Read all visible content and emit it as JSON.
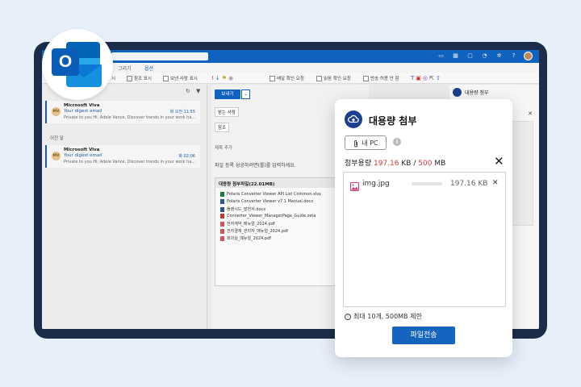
{
  "tabs": [
    "그리기",
    "옵션"
  ],
  "ribbon": {
    "items": [
      "참조 표시",
      "보낸 사람 표시",
      "배달 확인 요청",
      "읽음 확인 요청",
      "반송 허용 안 함"
    ],
    "left_text": "시"
  },
  "messages": [
    {
      "avatar": "MV",
      "from": "Microsoft Viva",
      "subject": "Your digest email",
      "time": "화 오전 11:55",
      "preview": "Private to you Hi, Adele Vance, Discover trends in your work ha..."
    },
    {
      "avatar": "MV",
      "from": "Microsoft Viva",
      "subject": "Your digest email",
      "time": "화 02:06",
      "preview": "Private to you Hi, Adele Vance, Discover trends in your work ha..."
    }
  ],
  "list_header": "이전 달",
  "compose": {
    "send_label": "보내기",
    "to_label": "받는 사람",
    "cc_label": "참조",
    "subject_label": "제목 추가",
    "body_text": "파일 등록 성공하려면(를)를 입력하세요.",
    "attach_title": "대용량 첨부파일(22.01MB)",
    "files": [
      "Polaris Converter Viewer API List Common.xlsx",
      "Polaris Converter Viewer v7.1 Manual.docx",
      "플랜시드_발전서.docx",
      "Converter_Viewer_ManagerPage_Guide.zeta",
      "전자계약_매뉴얼_2024.pdf",
      "전자결재_관리자_매뉴얼_2024.pdf",
      "회의실_매뉴얼_2024.pdf"
    ]
  },
  "right_panel": {
    "title": "대용량 첨부"
  },
  "modal": {
    "title": "대용량 첨부",
    "pc_button": "내 PC",
    "usage_label": "첨부용량",
    "usage_used": "197.16",
    "usage_used_unit": "KB",
    "usage_sep": "/",
    "usage_total": "500",
    "usage_total_unit": "MB",
    "file": {
      "name": "img.jpg",
      "size": "197.16 KB"
    },
    "limit_text": "최대 10개, 500MB 제한",
    "submit_label": "파일전송"
  },
  "colors": {
    "accent": "#1565c0",
    "warn": "#d63a3a",
    "outlook_blue": "#0a5eb8"
  },
  "icons": [
    "outlook-logo-icon",
    "cloud-upload-icon",
    "paperclip-icon",
    "info-icon",
    "close-icon",
    "image-file-icon"
  ]
}
